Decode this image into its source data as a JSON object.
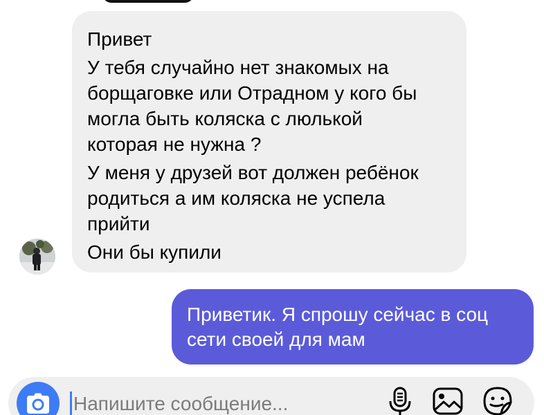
{
  "incoming_message": {
    "paragraphs": [
      [
        "Привет"
      ],
      [
        "У тебя случайно нет знакомых на",
        "борщаговке или Отрадном у кого бы",
        "могла быть коляска с люлькой",
        "которая не нужна ?"
      ],
      [
        "У меня у друзей вот должен ребёнок",
        "родиться а им коляска не успела",
        "прийти"
      ],
      [
        "Они бы купили"
      ]
    ]
  },
  "outgoing_message": {
    "lines": [
      "Приветик. Я спрошу сейчас в соц",
      "сети своей для мам"
    ]
  },
  "composer": {
    "placeholder": "Напишите сообщение...",
    "value": ""
  },
  "icons": {
    "camera": "camera-icon",
    "microphone": "microphone-icon",
    "gallery": "image-icon",
    "sticker": "sticker-icon"
  },
  "colors": {
    "incoming_bubble": "#efefef",
    "outgoing_bubble": "#5b5bd9",
    "accent": "#3d7cf4",
    "composer_bg": "#efefef"
  }
}
